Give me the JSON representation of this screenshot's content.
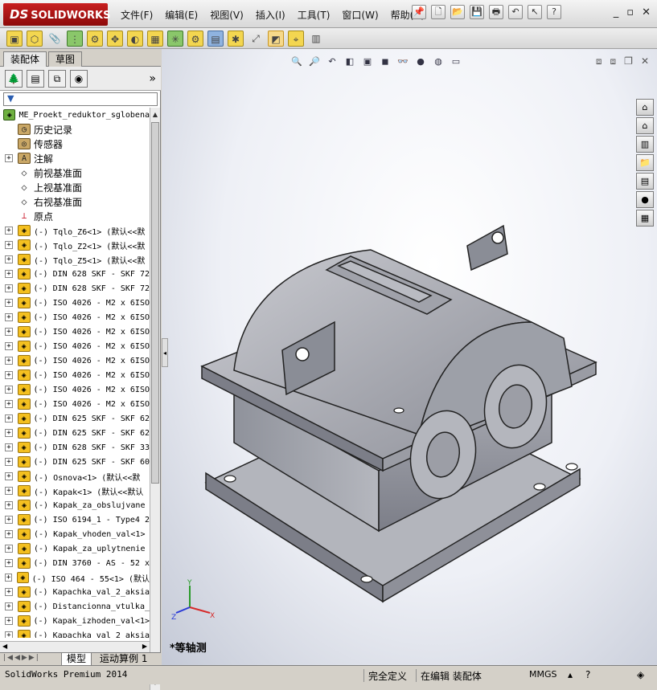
{
  "app": {
    "brand": "SOLIDWORKS",
    "brand_prefix": "DS"
  },
  "menu": [
    "文件(F)",
    "编辑(E)",
    "视图(V)",
    "插入(I)",
    "工具(T)",
    "窗口(W)",
    "帮助(H)"
  ],
  "left_panel": {
    "tabs": [
      "装配体",
      "草图"
    ],
    "filter_icon": "filter-icon",
    "tree_root": "ME_Proekt_reduktor_sglobena",
    "tree": [
      {
        "label": "历史记录",
        "icon": "history-icon",
        "expandable": false,
        "cjk": true
      },
      {
        "label": "传感器",
        "icon": "sensor-icon",
        "expandable": false,
        "cjk": true
      },
      {
        "label": "注解",
        "icon": "annotation-icon",
        "expandable": true,
        "cjk": true
      },
      {
        "label": "前视基准面",
        "icon": "plane-icon",
        "expandable": false,
        "cjk": true
      },
      {
        "label": "上视基准面",
        "icon": "plane-icon",
        "expandable": false,
        "cjk": true
      },
      {
        "label": "右视基准面",
        "icon": "plane-icon",
        "expandable": false,
        "cjk": true
      },
      {
        "label": "原点",
        "icon": "origin-icon",
        "expandable": false,
        "cjk": true
      },
      {
        "label": "(-) Tqlo_Z6<1> (默认<<默",
        "icon": "part-icon",
        "expandable": true
      },
      {
        "label": "(-) Tqlo_Z2<1> (默认<<默",
        "icon": "part-icon",
        "expandable": true
      },
      {
        "label": "(-) Tqlo_Z5<1> (默认<<默",
        "icon": "part-icon",
        "expandable": true
      },
      {
        "label": "(-) DIN 628 SKF - SKF 72",
        "icon": "part-icon",
        "expandable": true
      },
      {
        "label": "(-) DIN 628 SKF - SKF 72",
        "icon": "part-icon",
        "expandable": true
      },
      {
        "label": "(-) ISO 4026 - M2 x 6ISO",
        "icon": "part-icon",
        "expandable": true
      },
      {
        "label": "(-) ISO 4026 - M2 x 6ISO",
        "icon": "part-icon",
        "expandable": true
      },
      {
        "label": "(-) ISO 4026 - M2 x 6ISO",
        "icon": "part-icon",
        "expandable": true
      },
      {
        "label": "(-) ISO 4026 - M2 x 6ISO",
        "icon": "part-icon",
        "expandable": true
      },
      {
        "label": "(-) ISO 4026 - M2 x 6ISO",
        "icon": "part-icon",
        "expandable": true
      },
      {
        "label": "(-) ISO 4026 - M2 x 6ISO",
        "icon": "part-icon",
        "expandable": true
      },
      {
        "label": "(-) ISO 4026 - M2 x 6ISO",
        "icon": "part-icon",
        "expandable": true
      },
      {
        "label": "(-) ISO 4026 - M2 x 6ISO",
        "icon": "part-icon",
        "expandable": true
      },
      {
        "label": "(-) DIN 625 SKF - SKF 62",
        "icon": "part-icon",
        "expandable": true
      },
      {
        "label": "(-) DIN 625 SKF - SKF 62",
        "icon": "part-icon",
        "expandable": true
      },
      {
        "label": "(-) DIN 628 SKF - SKF 33",
        "icon": "part-icon",
        "expandable": true
      },
      {
        "label": "(-) DIN 625 SKF - SKF 60",
        "icon": "part-icon",
        "expandable": true
      },
      {
        "label": "(-) Osnova<1> (默认<<默",
        "icon": "part-icon",
        "expandable": true
      },
      {
        "label": "(-) Kapak<1> (默认<<默认",
        "icon": "part-icon",
        "expandable": true
      },
      {
        "label": "(-) Kapak_za_obslujvane",
        "icon": "part-icon",
        "expandable": true
      },
      {
        "label": "(-) ISO 6194_1 - Type4 2",
        "icon": "part-icon",
        "expandable": true
      },
      {
        "label": "(-) Kapak_vhoden_val<1>",
        "icon": "part-icon",
        "expandable": true
      },
      {
        "label": "(-) Kapak_za_uplytnenie",
        "icon": "part-icon",
        "expandable": true
      },
      {
        "label": "(-) DIN 3760 - AS - 52 x",
        "icon": "part-icon",
        "expandable": true
      },
      {
        "label": "(-) ISO 464 - 55<1> (默认",
        "icon": "part-icon",
        "expandable": true
      },
      {
        "label": "(-) Kapachka_val_2_aksia",
        "icon": "part-icon",
        "expandable": true
      },
      {
        "label": "(-) Distancionna_vtulka_",
        "icon": "part-icon",
        "expandable": true
      },
      {
        "label": "(-) Kapak_izhoden_val<1>",
        "icon": "part-icon",
        "expandable": true
      },
      {
        "label": "(-) Kapachka_val_2_aksia",
        "icon": "part-icon",
        "expandable": true
      }
    ],
    "bottom_tabs": [
      "模型",
      "运动算例 1"
    ]
  },
  "viewport": {
    "view_name": "*等轴测"
  },
  "status": {
    "product": "SolidWorks Premium 2014",
    "definition": "完全定义",
    "mode": "在编辑 装配体",
    "units": "MMGS"
  }
}
